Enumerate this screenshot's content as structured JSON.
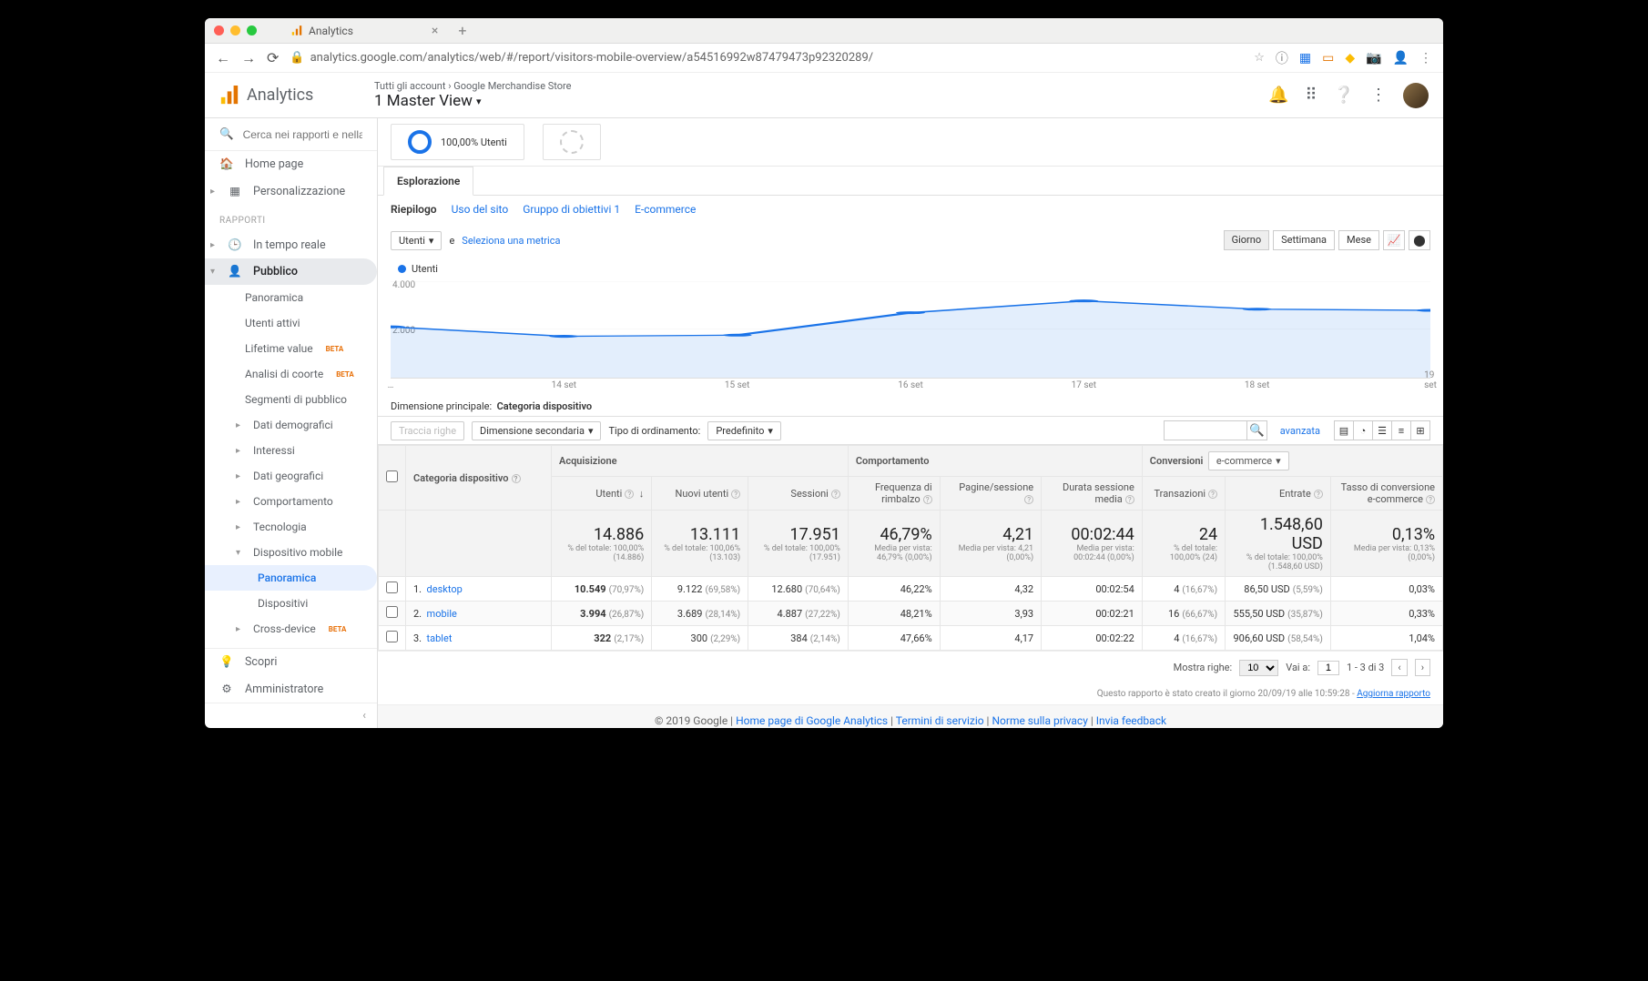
{
  "browser": {
    "tab_title": "Analytics",
    "url": "analytics.google.com/analytics/web/#/report/visitors-mobile-overview/a54516992w87479473p92320289/"
  },
  "header": {
    "product": "Analytics",
    "breadcrumb_all": "Tutti gli account",
    "breadcrumb_account": "Google Merchandise Store",
    "view": "1 Master View"
  },
  "sidebar": {
    "search_placeholder": "Cerca nei rapporti e nella Gu",
    "home": "Home page",
    "custom": "Personalizzazione",
    "section_reports": "RAPPORTI",
    "realtime": "In tempo reale",
    "audience": "Pubblico",
    "aud_overview": "Panoramica",
    "aud_active": "Utenti attivi",
    "aud_lifetime": "Lifetime value",
    "aud_cohort": "Analisi di coorte",
    "aud_segments": "Segmenti di pubblico",
    "aud_demo": "Dati demografici",
    "aud_interest": "Interessi",
    "aud_geo": "Dati geografici",
    "aud_behavior": "Comportamento",
    "aud_tech": "Tecnologia",
    "aud_mobile": "Dispositivo mobile",
    "aud_mobile_overview": "Panoramica",
    "aud_mobile_devices": "Dispositivi",
    "aud_cross": "Cross-device",
    "discover": "Scopri",
    "admin": "Amministratore",
    "beta": "BETA"
  },
  "segment": {
    "all_users": "100,00% Utenti"
  },
  "tabs": {
    "explore": "Esplorazione",
    "summary": "Riepilogo",
    "site": "Uso del sito",
    "goals": "Gruppo di obiettivi 1",
    "ecom": "E-commerce"
  },
  "metric": {
    "primary": "Utenti",
    "vs": "e",
    "select": "Seleziona una metrica",
    "day": "Giorno",
    "week": "Settimana",
    "month": "Mese"
  },
  "chart_data": {
    "type": "line",
    "title": "Utenti",
    "ylabel": "",
    "yticks": [
      2000,
      4000
    ],
    "ytick_labels": [
      "2.000",
      "4.000"
    ],
    "categories": [
      "…",
      "14 set",
      "15 set",
      "16 set",
      "17 set",
      "18 set",
      "19 set"
    ],
    "series": [
      {
        "name": "Utenti",
        "values": [
          2150,
          1750,
          1800,
          2750,
          3250,
          2900,
          2850
        ],
        "color": "#1a73e8"
      }
    ]
  },
  "dim": {
    "label": "Dimensione principale:",
    "value": "Categoria dispositivo"
  },
  "controls": {
    "plot": "Traccia righe",
    "secondary": "Dimensione secondaria",
    "sort_label": "Tipo di ordinamento:",
    "sort_value": "Predefinito",
    "advanced": "avanzata"
  },
  "table": {
    "groups": {
      "acq": "Acquisizione",
      "beh": "Comportamento",
      "conv": "Conversioni",
      "conv_sel": "e-commerce"
    },
    "cols": {
      "cat": "Categoria dispositivo",
      "users": "Utenti",
      "new_users": "Nuovi utenti",
      "sessions": "Sessioni",
      "bounce": "Frequenza di rimbalzo",
      "pages": "Pagine/sessione",
      "duration": "Durata sessione media",
      "trans": "Transazioni",
      "revenue": "Entrate",
      "conv_rate": "Tasso di conversione e-commerce"
    },
    "totals": {
      "users": "14.886",
      "users_sub": "% del totale: 100,00% (14.886)",
      "new_users": "13.111",
      "new_users_sub": "% del totale: 100,06% (13.103)",
      "sessions": "17.951",
      "sessions_sub": "% del totale: 100,00% (17.951)",
      "bounce": "46,79%",
      "bounce_sub": "Media per vista: 46,79% (0,00%)",
      "pages": "4,21",
      "pages_sub": "Media per vista: 4,21 (0,00%)",
      "duration": "00:02:44",
      "duration_sub": "Media per vista: 00:02:44 (0,00%)",
      "trans": "24",
      "trans_sub": "% del totale: 100,00% (24)",
      "revenue": "1.548,60 USD",
      "revenue_sub": "% del totale: 100,00% (1.548,60 USD)",
      "conv": "0,13%",
      "conv_sub": "Media per vista: 0,13% (0,00%)"
    },
    "rows": [
      {
        "n": "1.",
        "name": "desktop",
        "users": "10.549",
        "users_p": "(70,97%)",
        "nu": "9.122",
        "nu_p": "(69,58%)",
        "s": "12.680",
        "s_p": "(70,64%)",
        "b": "46,22%",
        "ps": "4,32",
        "d": "00:02:54",
        "t": "4",
        "t_p": "(16,67%)",
        "r": "86,50 USD",
        "r_p": "(5,59%)",
        "c": "0,03%"
      },
      {
        "n": "2.",
        "name": "mobile",
        "users": "3.994",
        "users_p": "(26,87%)",
        "nu": "3.689",
        "nu_p": "(28,14%)",
        "s": "4.887",
        "s_p": "(27,22%)",
        "b": "48,21%",
        "ps": "3,93",
        "d": "00:02:21",
        "t": "16",
        "t_p": "(66,67%)",
        "r": "555,50 USD",
        "r_p": "(35,87%)",
        "c": "0,33%"
      },
      {
        "n": "3.",
        "name": "tablet",
        "users": "322",
        "users_p": "(2,17%)",
        "nu": "300",
        "nu_p": "(2,29%)",
        "s": "384",
        "s_p": "(2,14%)",
        "b": "47,66%",
        "ps": "4,17",
        "d": "00:02:22",
        "t": "4",
        "t_p": "(16,67%)",
        "r": "906,60 USD",
        "r_p": "(58,54%)",
        "c": "1,04%"
      }
    ]
  },
  "pager": {
    "show": "Mostra righe:",
    "rows": "10",
    "goto": "Vai a:",
    "page": "1",
    "range": "1 - 3 di 3"
  },
  "foot": {
    "gen": "Questo rapporto è stato creato il giorno 20/09/19 alle 10:59:28 - ",
    "refresh": "Aggiorna rapporto"
  },
  "footer": {
    "copy": "© 2019 Google",
    "home": "Home page di Google Analytics",
    "tos": "Termini di servizio",
    "privacy": "Norme sulla privacy",
    "feedback": "Invia feedback"
  }
}
